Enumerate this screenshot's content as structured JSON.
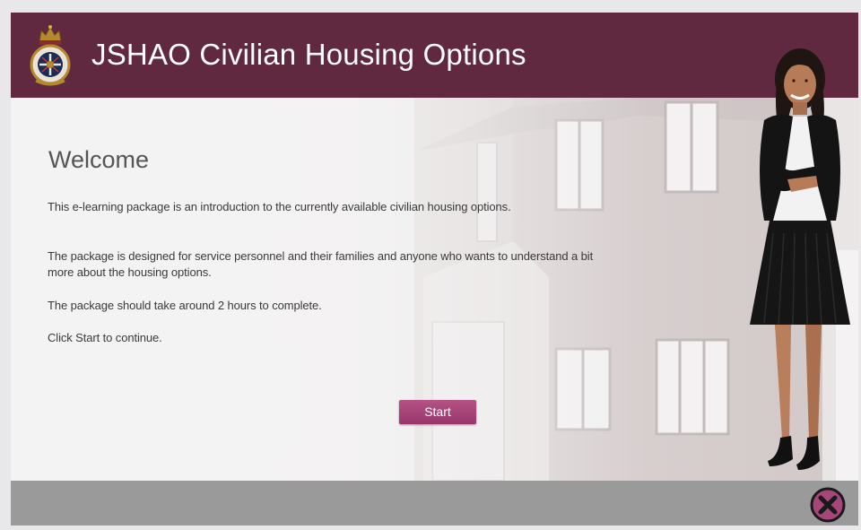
{
  "header": {
    "title": "JSHAO Civilian Housing Options",
    "background_color": "#612940",
    "logo_icon": "crest-logo-icon"
  },
  "main": {
    "heading": "Welcome",
    "paragraphs": [
      "This e-learning package is an introduction to the currently available civilian housing options.",
      "The package is designed for service personnel and their families and anyone who wants to understand a bit more about the housing options.",
      "The package should take around 2 hours to complete.",
      "Click Start to continue."
    ],
    "start_label": "Start",
    "button_color": "#a7467a"
  },
  "footer": {
    "background_color": "#9a9a9a",
    "close_icon": "close-icon"
  }
}
